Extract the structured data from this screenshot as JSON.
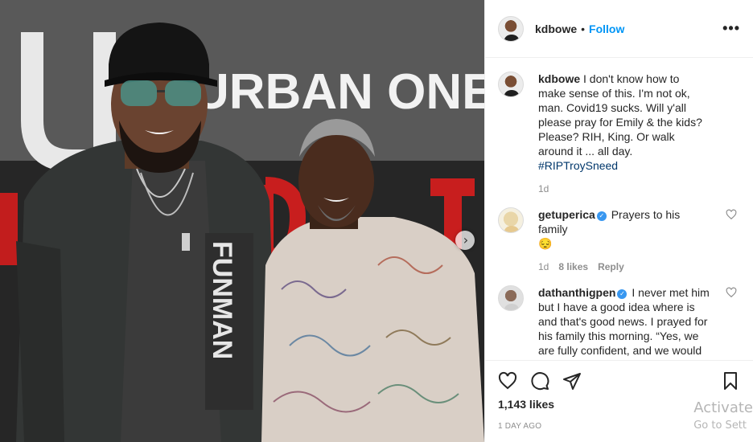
{
  "post": {
    "username": "kdbowe",
    "follow_label": "Follow",
    "more_label": "•••",
    "backdrop_text": "URBAN ONE",
    "likes": "1,143 likes",
    "timestamp": "1 day ago"
  },
  "caption": {
    "username": "kdbowe",
    "text": "I don't know how to make sense of this. I'm not ok, man. Covid19 sucks. Will y'all please pray for Emily & the kids? Please? RIH, King. Or walk around it ... all day.",
    "hashtag": "#RIPTroySneed",
    "age": "1d"
  },
  "comments": [
    {
      "username": "getuperica",
      "text": "Prayers to his family",
      "emoji": "😔",
      "age": "1d",
      "likes": "8 likes",
      "reply_label": "Reply"
    },
    {
      "username": "dathanthigpen",
      "text": "I never met him but I have a good idea where is and that's good news. I prayed for his family this morning. “Yes, we are fully confident, and we would rather be away from these earthly bodies, for then we will be at"
    }
  ],
  "watermark": {
    "line1": "Activate",
    "line2": "Go to Sett"
  },
  "icons": [
    "heart-icon",
    "comment-icon",
    "share-icon",
    "bookmark-icon",
    "verified-badge-icon",
    "carousel-next-icon"
  ],
  "colors": {
    "accent": "#0095f6",
    "text": "#262626",
    "muted": "#8e8e8e",
    "verified": "#3897f0"
  }
}
